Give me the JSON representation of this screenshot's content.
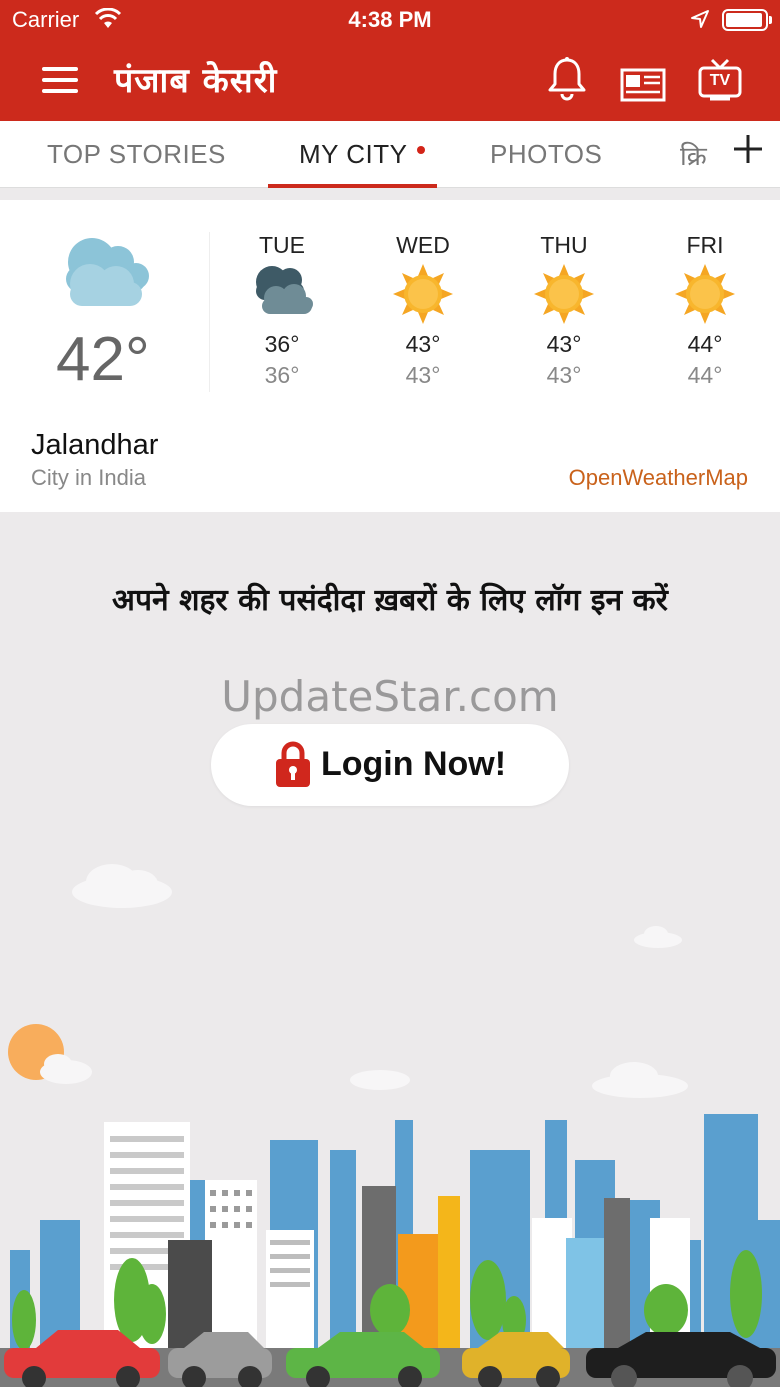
{
  "status_bar": {
    "carrier": "Carrier",
    "time": "4:38 PM"
  },
  "header": {
    "brand": "पंजाब केसरी",
    "icons": [
      "menu-icon",
      "bell-icon",
      "epaper-icon",
      "tv-icon"
    ],
    "tv_label": "TV",
    "color": "#cc2a1c"
  },
  "tabs": {
    "items": [
      {
        "label": "TOP STORIES",
        "active": false
      },
      {
        "label": "MY CITY",
        "active": true
      },
      {
        "label": "PHOTOS",
        "active": false
      },
      {
        "label": "क्रि",
        "active": false
      }
    ]
  },
  "weather": {
    "current_temp": "42°",
    "current_icon": "cloudy-icon",
    "forecast": [
      {
        "day": "TUE",
        "icon": "dark-cloud-icon",
        "high": "36°",
        "low": "36°"
      },
      {
        "day": "WED",
        "icon": "sun-icon",
        "high": "43°",
        "low": "43°"
      },
      {
        "day": "THU",
        "icon": "sun-icon",
        "high": "43°",
        "low": "43°"
      },
      {
        "day": "FRI",
        "icon": "sun-icon",
        "high": "44°",
        "low": "44°"
      }
    ],
    "city": "Jalandhar",
    "subtitle": "City in India",
    "provider": "OpenWeatherMap"
  },
  "login": {
    "prompt": "अपने शहर की पसंदीदा ख़बरों के लिए लॉग इन करें",
    "watermark": "UpdateStar.com",
    "button_label": "Login Now!",
    "button_icon": "lock-icon"
  }
}
